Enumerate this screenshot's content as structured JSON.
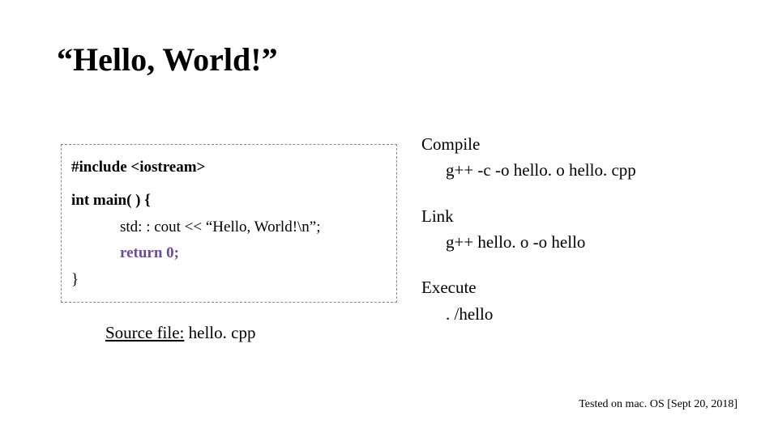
{
  "title": "“Hello, World!”",
  "code": {
    "include": "#include <iostream>",
    "main_sig": "int main( ) {",
    "cout": "std: : cout << “Hello, World!\\n”;",
    "return_kw": "return",
    "return_val": "0;",
    "close_brace": "}"
  },
  "source_file": {
    "label_underlined": "Source file:",
    "filename": " hello. cpp"
  },
  "steps": {
    "compile": {
      "label": "Compile",
      "cmd": "g++  -c  -o  hello. o  hello. cpp"
    },
    "link": {
      "label": "Link",
      "cmd": "g++  hello. o  -o  hello"
    },
    "execute": {
      "label": "Execute",
      "cmd": ". /hello"
    }
  },
  "footer": "Tested on mac. OS [Sept 20, 2018]"
}
